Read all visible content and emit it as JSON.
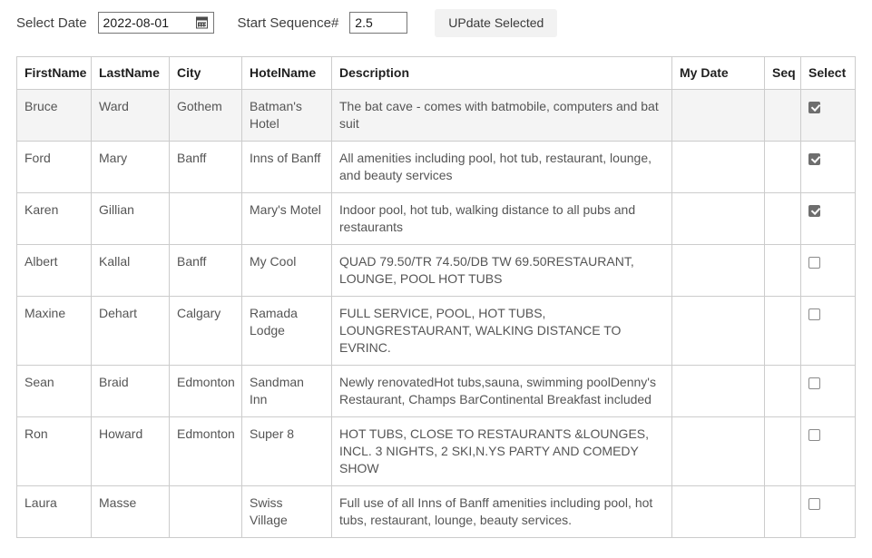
{
  "toolbar": {
    "date_label": "Select Date",
    "date_value": "2022-08-01",
    "date_icon": "calendar-icon",
    "seq_label": "Start Sequence#",
    "seq_value": "2.5",
    "update_label": "UPdate Selected"
  },
  "table": {
    "columns": [
      "FirstName",
      "LastName",
      "City",
      "HotelName",
      "Description",
      "My Date",
      "Seq",
      "Select"
    ],
    "rows": [
      {
        "firstname": "Bruce",
        "lastname": "Ward",
        "city": "Gothem",
        "hotelname": "Batman's Hotel",
        "description": "The bat cave - comes with batmobile, computers and bat suit",
        "mydate": "",
        "seq": "",
        "selected": true,
        "highlight": true
      },
      {
        "firstname": "Ford",
        "lastname": "Mary",
        "city": "Banff",
        "hotelname": "Inns of Banff",
        "description": "All amenities including pool, hot tub, restaurant, lounge, and beauty services",
        "mydate": "",
        "seq": "",
        "selected": true,
        "highlight": false
      },
      {
        "firstname": "Karen",
        "lastname": "Gillian",
        "city": "",
        "hotelname": "Mary's Motel",
        "description": "Indoor pool, hot tub, walking distance to all pubs and restaurants",
        "mydate": "",
        "seq": "",
        "selected": true,
        "highlight": false
      },
      {
        "firstname": "Albert",
        "lastname": "Kallal",
        "city": "Banff",
        "hotelname": "My Cool",
        "description": "QUAD 79.50/TR 74.50/DB TW 69.50RESTAURANT, LOUNGE, POOL HOT TUBS",
        "mydate": "",
        "seq": "",
        "selected": false,
        "highlight": false
      },
      {
        "firstname": "Maxine",
        "lastname": "Dehart",
        "city": "Calgary",
        "hotelname": "Ramada Lodge",
        "description": "FULL SERVICE, POOL, HOT TUBS, LOUNGRESTAURANT, WALKING DISTANCE TO EVRINC.",
        "mydate": "",
        "seq": "",
        "selected": false,
        "highlight": false
      },
      {
        "firstname": "Sean",
        "lastname": "Braid",
        "city": "Edmonton",
        "hotelname": "Sandman Inn",
        "description": "Newly renovatedHot tubs,sauna, swimming poolDenny's Restaurant, Champs BarContinental Breakfast included",
        "mydate": "",
        "seq": "",
        "selected": false,
        "highlight": false
      },
      {
        "firstname": "Ron",
        "lastname": "Howard",
        "city": "Edmonton",
        "hotelname": "Super 8",
        "description": "HOT TUBS, CLOSE TO RESTAURANTS &LOUNGES, INCL. 3 NIGHTS, 2 SKI,N.YS PARTY AND COMEDY SHOW",
        "mydate": "",
        "seq": "",
        "selected": false,
        "highlight": false
      },
      {
        "firstname": "Laura",
        "lastname": "Masse",
        "city": "",
        "hotelname": "Swiss Village",
        "description": "Full use of all Inns of Banff amenities including pool, hot tubs, restaurant, lounge, beauty services.",
        "mydate": "",
        "seq": "",
        "selected": false,
        "highlight": false
      }
    ]
  }
}
